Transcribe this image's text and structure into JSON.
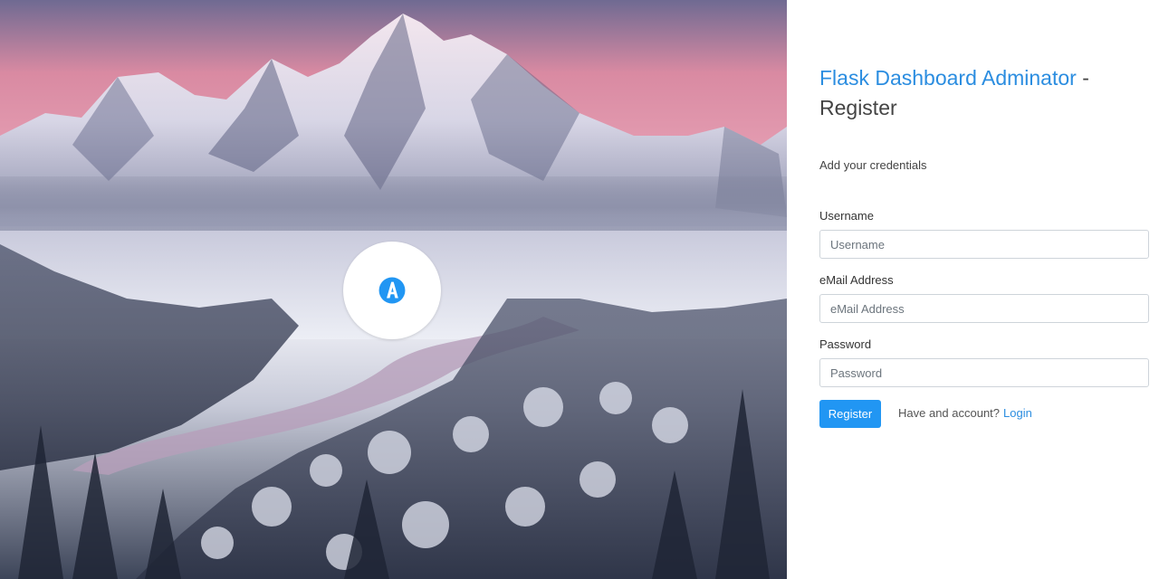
{
  "hero": {
    "logo_icon": "a-letter-logo-icon",
    "image_subject": "snowy-mountain-landscape"
  },
  "header": {
    "brand": "Flask Dashboard Adminator",
    "separator": " - ",
    "page": "Register"
  },
  "subtitle": "Add your credentials",
  "form": {
    "username": {
      "label": "Username",
      "placeholder": "Username",
      "value": ""
    },
    "email": {
      "label": "eMail Address",
      "placeholder": "eMail Address",
      "value": ""
    },
    "password": {
      "label": "Password",
      "placeholder": "Password",
      "value": ""
    },
    "submit_label": "Register",
    "have_account_text": "Have and account?",
    "login_link": "Login"
  },
  "colors": {
    "accent": "#2196f3",
    "link": "#2b8de0",
    "text": "#444444"
  }
}
